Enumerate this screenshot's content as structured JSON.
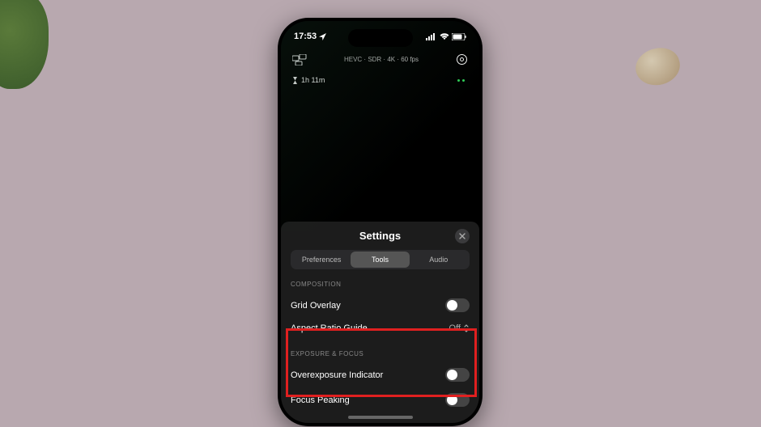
{
  "status": {
    "time": "17:53",
    "location_icon": "location-arrow"
  },
  "camera": {
    "format": "HEVC · SDR · 4K · 60 fps",
    "recording_time": "1h 11m"
  },
  "settings": {
    "title": "Settings",
    "tabs": {
      "preferences": "Preferences",
      "tools": "Tools",
      "audio": "Audio"
    },
    "sections": {
      "composition": {
        "label": "COMPOSITION",
        "grid_overlay": "Grid Overlay",
        "aspect_ratio": "Aspect Ratio Guide",
        "aspect_value": "Off"
      },
      "exposure": {
        "label": "EXPOSURE & FOCUS",
        "overexposure": "Overexposure Indicator",
        "focus_peaking": "Focus Peaking"
      }
    }
  }
}
